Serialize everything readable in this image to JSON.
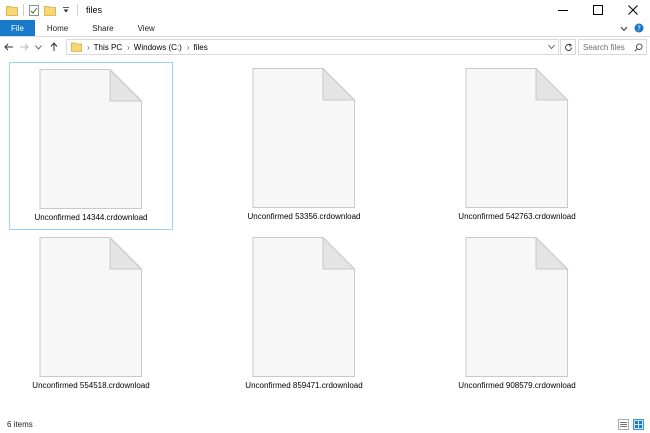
{
  "window": {
    "title": "files"
  },
  "ribbon": {
    "tabs": [
      {
        "label": "File"
      },
      {
        "label": "Home"
      },
      {
        "label": "Share"
      },
      {
        "label": "View"
      }
    ]
  },
  "address": {
    "crumbs": [
      "This PC",
      "Windows (C:)",
      "files"
    ]
  },
  "search": {
    "placeholder": "Search files"
  },
  "files": [
    {
      "name": "Unconfirmed 14344.crdownload"
    },
    {
      "name": "Unconfirmed 53356.crdownload"
    },
    {
      "name": "Unconfirmed 542763.crdownload"
    },
    {
      "name": "Unconfirmed 554518.crdownload"
    },
    {
      "name": "Unconfirmed 859471.crdownload"
    },
    {
      "name": "Unconfirmed 908579.crdownload"
    }
  ],
  "status": {
    "item_count": "6 items"
  },
  "colors": {
    "accent": "#1979ca",
    "selection_border": "#99d1ff"
  }
}
